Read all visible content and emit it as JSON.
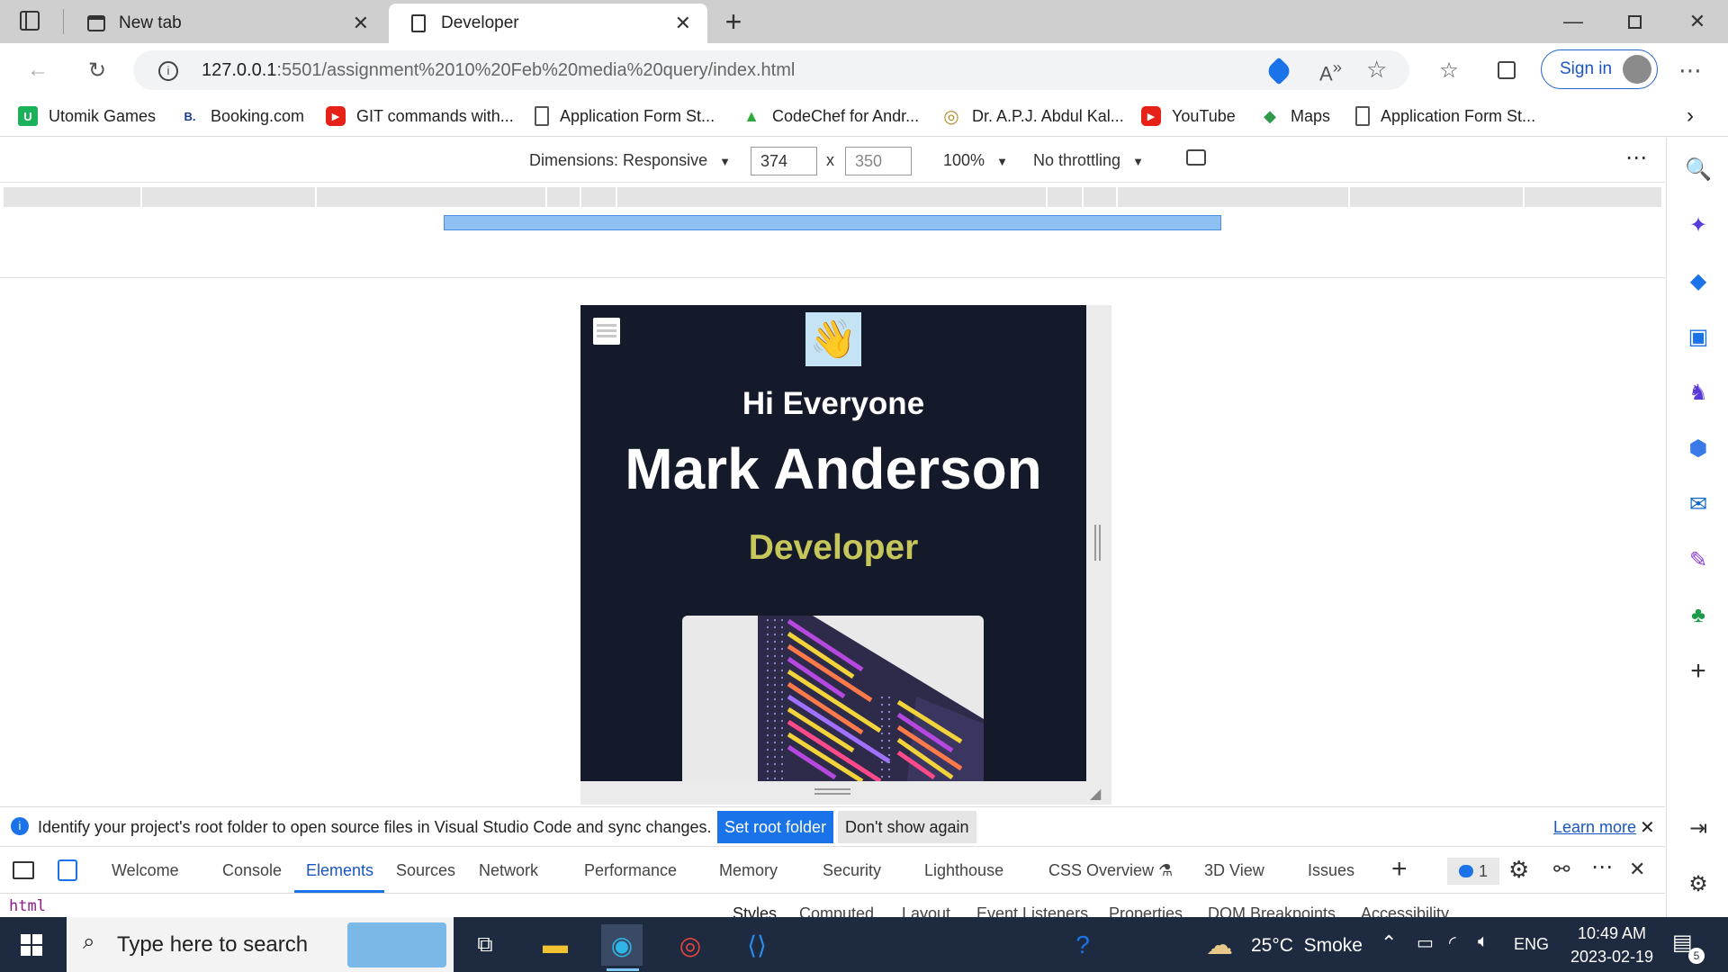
{
  "browser": {
    "tabs": [
      {
        "title": "New tab"
      },
      {
        "title": "Developer"
      }
    ],
    "url_host": "127.0.0.1",
    "url_rest": ":5501/assignment%2010%20Feb%20media%20query/index.html",
    "sign_in_label": "Sign in"
  },
  "bookmarks": [
    {
      "label": "Utomik Games",
      "icon": "utomik-icon",
      "icon_text": "U",
      "color": "#1bb05a"
    },
    {
      "label": "Booking.com",
      "icon": "booking-icon",
      "icon_text": "B.",
      "color": "#1b3a8a"
    },
    {
      "label": "GIT commands with...",
      "icon": "youtube-icon",
      "icon_text": "▶",
      "color": "#e62117"
    },
    {
      "label": "Application Form St...",
      "icon": "document-icon",
      "icon_text": "",
      "color": "#555555"
    },
    {
      "label": "CodeChef for Andr...",
      "icon": "codechef-icon",
      "icon_text": "▲",
      "color": "#2faa3a"
    },
    {
      "label": "Dr. A.P.J. Abdul Kal...",
      "icon": "seal-icon",
      "icon_text": "◎",
      "color": "#b88a2a"
    },
    {
      "label": "YouTube",
      "icon": "youtube-icon",
      "icon_text": "▶",
      "color": "#e62117"
    },
    {
      "label": "Maps",
      "icon": "maps-icon",
      "icon_text": "◆",
      "color": "#2e9a4a"
    },
    {
      "label": "Application Form St...",
      "icon": "document-icon",
      "icon_text": "",
      "color": "#555555"
    }
  ],
  "device_toolbar": {
    "dimensions_label": "Dimensions: Responsive",
    "width_value": "374",
    "height_placeholder": "350",
    "times": "x",
    "zoom": "100%",
    "throttling": "No throttling"
  },
  "page": {
    "greeting": "Hi Everyone",
    "name": "Mark Anderson",
    "role": "Developer",
    "background": "#141a2a",
    "role_color": "#c6c65a"
  },
  "infobar": {
    "message": "Identify your project's root folder to open source files in Visual Studio Code and sync changes.",
    "set_root": "Set root folder",
    "dont_show": "Don't show again",
    "learn_more": "Learn more"
  },
  "devtools": {
    "tabs": [
      "Welcome",
      "Console",
      "Elements",
      "Sources",
      "Network",
      "Performance",
      "Memory",
      "Security",
      "Lighthouse",
      "CSS Overview",
      "3D View",
      "Issues"
    ],
    "active_tab": "Elements",
    "issues_count": "1",
    "dom_html": "html",
    "style_tabs": [
      "Styles",
      "Computed",
      "Layout",
      "Event Listeners",
      "Properties",
      "DOM Breakpoints",
      "Accessibility"
    ]
  },
  "taskbar": {
    "search_placeholder": "Type here to search",
    "weather": "25°C  Smoke",
    "lang": "ENG",
    "time": "10:49 AM",
    "date": "2023-02-19",
    "notification_count": "5"
  }
}
